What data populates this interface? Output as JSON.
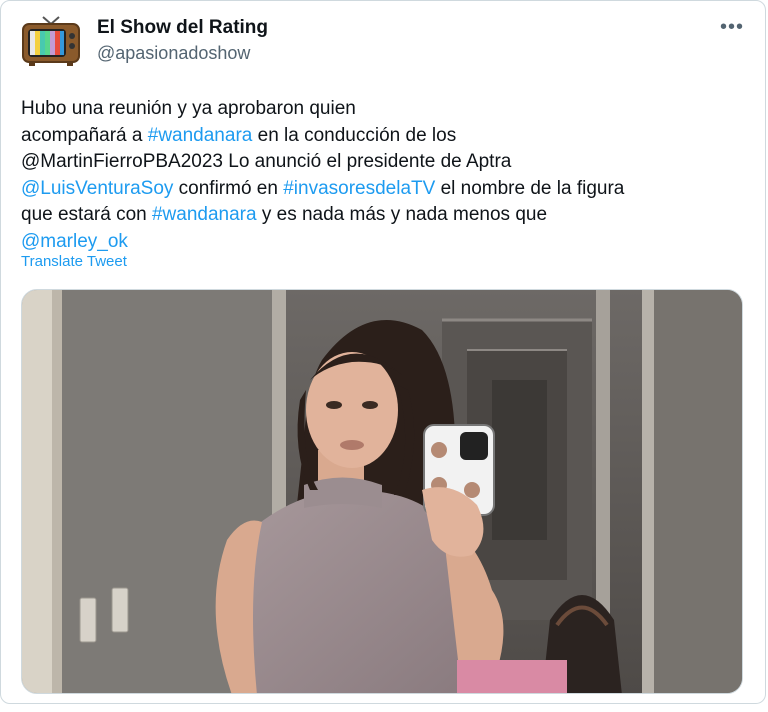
{
  "author": {
    "name": "El Show del Rating",
    "handle": "@apasionadoshow",
    "avatar_icon": "retro-tv-icon"
  },
  "more_icon": "more-options-icon",
  "tweet": {
    "lines": [
      [
        {
          "text": "Hubo una reunión y ya aprobaron quien",
          "link": false
        }
      ],
      [
        {
          "text": "acompañará a  ",
          "link": false
        },
        {
          "text": "#wandanara",
          "link": true
        },
        {
          "text": " en la conducción de los",
          "link": false
        }
      ],
      [
        {
          "text": "@MartinFierroPBA2023 Lo anunció el presidente de Aptra",
          "link": false
        }
      ],
      [
        {
          "text": "@LuisVenturaSoy",
          "link": true
        },
        {
          "text": " confirmó en ",
          "link": false
        },
        {
          "text": "#invasoresdelaTV",
          "link": true
        },
        {
          "text": " el nombre de la figura",
          "link": false
        }
      ],
      [
        {
          "text": "que estará con ",
          "link": false
        },
        {
          "text": "#wandanara",
          "link": true
        },
        {
          "text": " y es nada más y nada menos que",
          "link": false
        }
      ],
      [
        {
          "text": "@marley_ok",
          "link": true
        }
      ]
    ],
    "translate_label": "Translate Tweet"
  },
  "media": {
    "kind": "photo",
    "subject_icon": "mirror-selfie-photo"
  },
  "colors": {
    "link": "#1d9bf0",
    "text": "#0f1419",
    "secondary": "#536471",
    "border": "#cfd9de"
  }
}
